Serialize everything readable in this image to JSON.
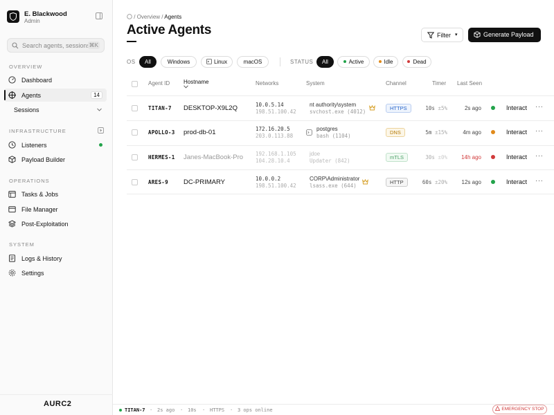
{
  "user": {
    "name": "E. Blackwood",
    "role": "Admin"
  },
  "search": {
    "placeholder": "Search agents, sessions...",
    "shortcut": "⌘K"
  },
  "sidebar": {
    "overview_label": "OVERVIEW",
    "dashboard": "Dashboard",
    "agents": "Agents",
    "agents_count": "14",
    "sessions": "Sessions",
    "infrastructure_label": "INFRASTRUCTURE",
    "listeners": "Listeners",
    "payload_builder": "Payload Builder",
    "operations_label": "OPERATIONS",
    "tasks_jobs": "Tasks & Jobs",
    "file_manager": "File Manager",
    "post_exploitation": "Post-Exploitation",
    "system_label": "SYSTEM",
    "logs_history": "Logs & History",
    "settings": "Settings",
    "brand": "AURC2"
  },
  "breadcrumb": {
    "sep": "/",
    "overview": "Overview",
    "current": "Agents"
  },
  "page": {
    "title": "Active Agents",
    "filter_label": "Filter",
    "generate_label": "Generate Payload"
  },
  "filters": {
    "os_label": "OS",
    "os": [
      "All",
      "Windows",
      "Linux",
      "macOS"
    ],
    "status_label": "STATUS",
    "status": [
      "All",
      "Active",
      "Idle",
      "Dead"
    ]
  },
  "table": {
    "headers": {
      "agent_id": "Agent ID",
      "hostname": "Hostname",
      "networks": "Networks",
      "system": "System",
      "channel": "Channel",
      "timer": "Timer",
      "last_seen": "Last Seen"
    },
    "rows": [
      {
        "id": "TITAN-7",
        "host": "DESKTOP-X9L2Q",
        "ip1": "10.0.5.14",
        "ip2": "198.51.100.42",
        "user": "nt authority\\system",
        "proc": "svchost.exe (4012)",
        "channel": "HTTPS",
        "timer": "10s",
        "jitter": "±5%",
        "seen": "2s ago",
        "status": "active",
        "action": "Interact",
        "more": "···"
      },
      {
        "id": "APOLLO-3",
        "host": "prod-db-01",
        "ip1": "172.16.20.5",
        "ip2": "203.0.113.88",
        "user": "postgres",
        "proc": "bash (1104)",
        "channel": "DNS",
        "timer": "5m",
        "jitter": "±15%",
        "seen": "4m ago",
        "status": "idle",
        "action": "Interact",
        "more": "···"
      },
      {
        "id": "HERMES-1",
        "host": "Janes-MacBook-Pro",
        "ip1": "192.168.1.105",
        "ip2": "104.28.10.4",
        "user": "jdoe",
        "proc": "Updater (842)",
        "channel": "mTLS",
        "timer": "30s",
        "jitter": "±0%",
        "seen": "14h ago",
        "status": "dead",
        "action": "Interact",
        "more": "···"
      },
      {
        "id": "ARES-9",
        "host": "DC-PRIMARY",
        "ip1": "10.0.0.2",
        "ip2": "198.51.100.42",
        "user": "CORP\\Administrator",
        "proc": "lsass.exe (644)",
        "channel": "HTTP",
        "timer": "60s",
        "jitter": "±20%",
        "seen": "12s ago",
        "status": "active",
        "action": "Interact",
        "more": "···"
      }
    ]
  },
  "statusbar": {
    "agent": "TITAN-7",
    "sep": "·",
    "seen": "2s ago",
    "timer": "10s",
    "channel": "HTTPS",
    "ops": "3 ops online",
    "estop": "EMERGENCY STOP"
  },
  "colors": {
    "active": "#22a34a",
    "idle": "#e08a1a",
    "dead": "#d13a3a",
    "accent": "#111111"
  }
}
